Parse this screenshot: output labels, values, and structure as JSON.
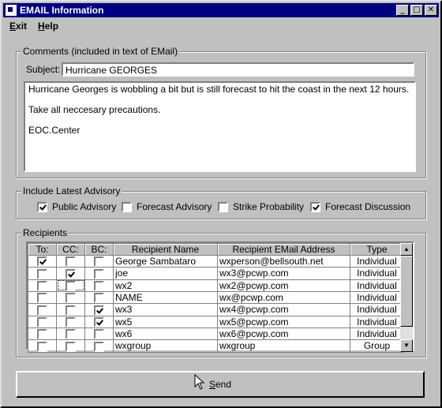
{
  "window": {
    "title": "EMAIL Information",
    "minimize": "_",
    "maximize": "□",
    "close": "✕"
  },
  "menu": {
    "exit": "Exit",
    "help": "Help"
  },
  "comments": {
    "legend": "Comments (included in text of EMail)",
    "subject_label": "Subject:",
    "subject_value": "Hurricane GEORGES",
    "body_lines": [
      "Hurricane Georges is wobbling a bit but is still forecast to hit the coast in the next 12 hours.",
      "Take all neccesary precautions.",
      "EOC.Center"
    ]
  },
  "advisory": {
    "legend": "Include Latest Advisory",
    "options": [
      {
        "label": "Public Advisory",
        "checked": true
      },
      {
        "label": "Forecast Advisory",
        "checked": false
      },
      {
        "label": "Strike Probability",
        "checked": false
      },
      {
        "label": "Forecast Discussion",
        "checked": true
      }
    ]
  },
  "recipients": {
    "legend": "Recipients",
    "columns": [
      "To:",
      "CC:",
      "BC:",
      "Recipient Name",
      "Recipient EMail Address",
      "Type"
    ],
    "rows": [
      {
        "to": true,
        "cc": false,
        "bc": false,
        "name": "George Sambataro",
        "email": "wxperson@bellsouth.net",
        "type": "Individual"
      },
      {
        "to": false,
        "cc": true,
        "bc": false,
        "name": "joe",
        "email": "wx3@pcwp.com",
        "type": "Individual"
      },
      {
        "to": false,
        "cc": false,
        "bc": false,
        "name": "wx2",
        "email": "wx2@pcwp.com",
        "type": "Individual"
      },
      {
        "to": false,
        "cc": false,
        "bc": false,
        "name": "NAME",
        "email": "wx@pcwp.com",
        "type": "Individual"
      },
      {
        "to": false,
        "cc": false,
        "bc": true,
        "name": "wx3",
        "email": "wx4@pcwp.com",
        "type": "Individual"
      },
      {
        "to": false,
        "cc": false,
        "bc": true,
        "name": "wx5",
        "email": "wx5@pcwp.com",
        "type": "Individual"
      },
      {
        "to": false,
        "cc": false,
        "bc": false,
        "name": "wx6",
        "email": "wx6@pcwp.com",
        "type": "Individual"
      },
      {
        "to": false,
        "cc": false,
        "bc": false,
        "name": "wxgroup",
        "email": "wxgroup",
        "type": "Group"
      }
    ]
  },
  "send_label": "Send",
  "icons": {
    "app": "mail-app-icon",
    "cursor": "arrow-cursor-icon"
  }
}
